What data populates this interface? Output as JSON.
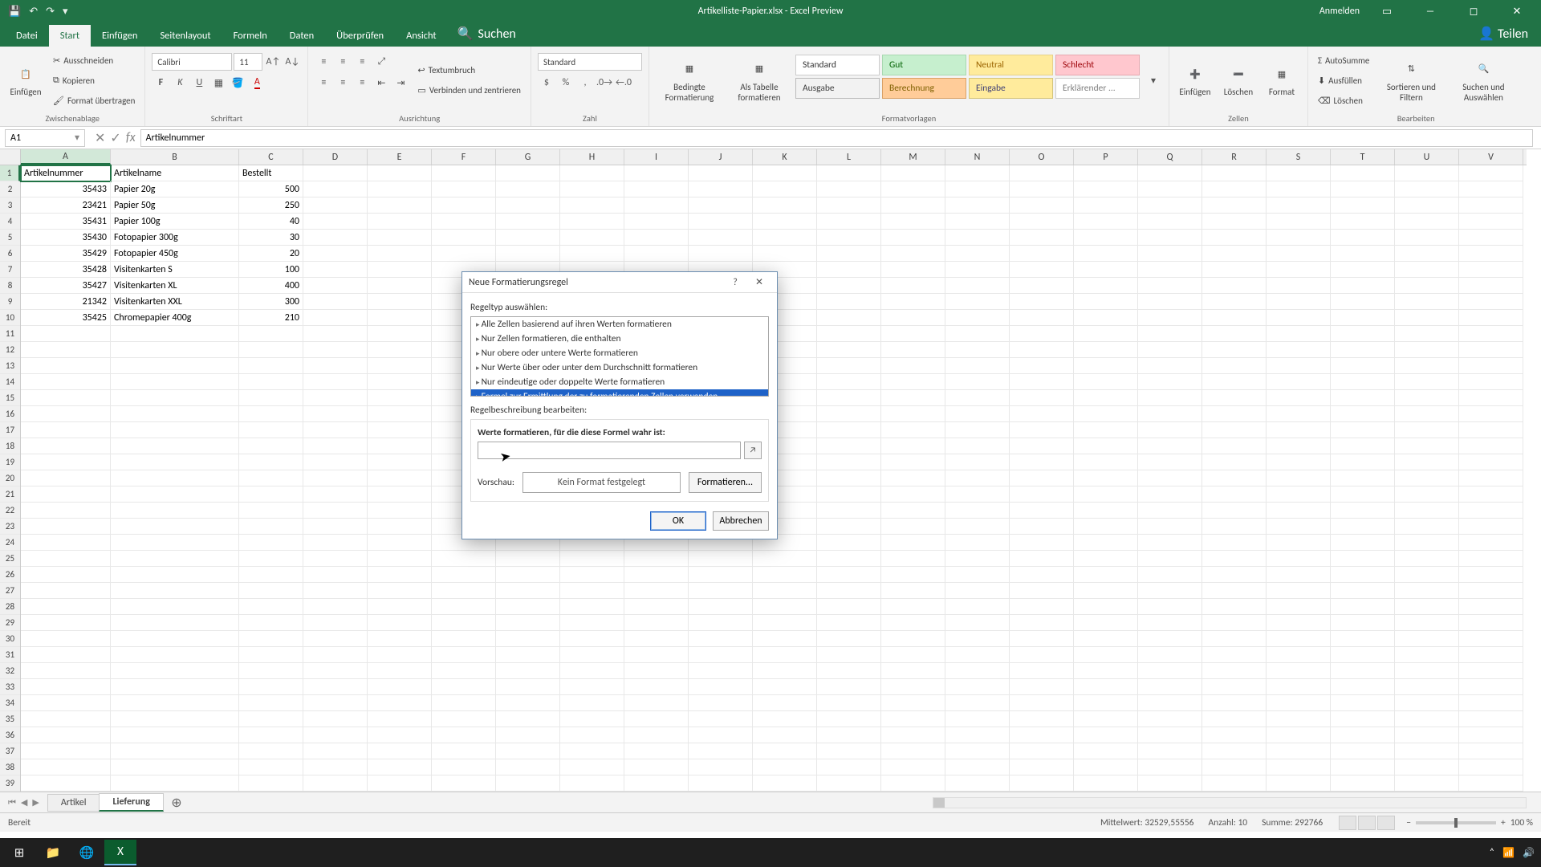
{
  "titlebar": {
    "title": "Artikelliste-Papier.xlsx - Excel Preview",
    "signin": "Anmelden"
  },
  "tabs": {
    "items": [
      "Datei",
      "Start",
      "Einfügen",
      "Seitenlayout",
      "Formeln",
      "Daten",
      "Überprüfen",
      "Ansicht"
    ],
    "active": "Start",
    "search": "Suchen",
    "share": "Teilen"
  },
  "ribbon": {
    "clipboard": {
      "paste": "Einfügen",
      "cut": "Ausschneiden",
      "copy": "Kopieren",
      "format_painter": "Format übertragen",
      "label": "Zwischenablage"
    },
    "font": {
      "name": "Calibri",
      "size": "11",
      "label": "Schriftart"
    },
    "alignment": {
      "wrap": "Textumbruch",
      "merge": "Verbinden und zentrieren",
      "label": "Ausrichtung"
    },
    "number": {
      "format": "Standard",
      "label": "Zahl"
    },
    "styles": {
      "cond": "Bedingte Formatierung",
      "astable": "Als Tabelle formatieren",
      "label": "Formatvorlagen",
      "gallery": [
        {
          "text": "Standard",
          "bg": "#ffffff",
          "fg": "#333",
          "border": "#ccc"
        },
        {
          "text": "Gut",
          "bg": "#c6efce",
          "fg": "#006100",
          "border": "#a8d8b0"
        },
        {
          "text": "Neutral",
          "bg": "#ffeb9c",
          "fg": "#9c6500",
          "border": "#e6d18a"
        },
        {
          "text": "Schlecht",
          "bg": "#ffc7ce",
          "fg": "#9c0006",
          "border": "#e6a8b0"
        },
        {
          "text": "Ausgabe",
          "bg": "#f2f2f2",
          "fg": "#3f3f3f",
          "border": "#bbb"
        },
        {
          "text": "Berechnung",
          "bg": "#ffcc99",
          "fg": "#7f6000",
          "border": "#d9a066"
        },
        {
          "text": "Eingabe",
          "bg": "#ffeb9c",
          "fg": "#3f3f76",
          "border": "#d4c47a"
        },
        {
          "text": "Erklärender ...",
          "bg": "#ffffff",
          "fg": "#7f7f7f",
          "border": "#ccc"
        }
      ]
    },
    "cells": {
      "insert": "Einfügen",
      "delete": "Löschen",
      "format": "Format",
      "label": "Zellen"
    },
    "editing": {
      "autosum": "AutoSumme",
      "fill": "Ausfüllen",
      "clear": "Löschen",
      "sort": "Sortieren und Filtern",
      "find": "Suchen und Auswählen",
      "label": "Bearbeiten"
    }
  },
  "fxbar": {
    "name": "A1",
    "formula": "Artikelnummer"
  },
  "grid": {
    "cols": [
      "A",
      "B",
      "C",
      "D",
      "E",
      "F",
      "G",
      "H",
      "I",
      "J",
      "K",
      "L",
      "M",
      "N",
      "O",
      "P",
      "Q",
      "R",
      "S",
      "T",
      "U",
      "V"
    ],
    "rows": 39,
    "headers_row": [
      "Artikelnummer",
      "Artikelname",
      "Bestellt"
    ],
    "data": [
      {
        "nr": "35433",
        "name": "Papier 20g",
        "qty": "500"
      },
      {
        "nr": "23421",
        "name": "Papier 50g",
        "qty": "250"
      },
      {
        "nr": "35431",
        "name": "Papier 100g",
        "qty": "40"
      },
      {
        "nr": "35430",
        "name": "Fotopapier 300g",
        "qty": "30"
      },
      {
        "nr": "35429",
        "name": "Fotopapier 450g",
        "qty": "20"
      },
      {
        "nr": "35428",
        "name": "Visitenkarten S",
        "qty": "100"
      },
      {
        "nr": "35427",
        "name": "Visitenkarten XL",
        "qty": "400"
      },
      {
        "nr": "21342",
        "name": "Visitenkarten XXL",
        "qty": "300"
      },
      {
        "nr": "35425",
        "name": "Chromepapier 400g",
        "qty": "210"
      }
    ]
  },
  "sheettabs": {
    "tabs": [
      "Artikel",
      "Lieferung"
    ],
    "active": "Lieferung"
  },
  "status": {
    "ready": "Bereit",
    "avg_label": "Mittelwert:",
    "avg": "32529,55556",
    "count_label": "Anzahl:",
    "count": "10",
    "sum_label": "Summe:",
    "sum": "292766",
    "zoom": "100 %"
  },
  "dialog": {
    "title": "Neue Formatierungsregel",
    "select_type": "Regeltyp auswählen:",
    "types": [
      "Alle Zellen basierend auf ihren Werten formatieren",
      "Nur Zellen formatieren, die enthalten",
      "Nur obere oder untere Werte formatieren",
      "Nur Werte über oder unter dem Durchschnitt formatieren",
      "Nur eindeutige oder doppelte Werte formatieren",
      "Formel zur Ermittlung der zu formatierenden Zellen verwenden"
    ],
    "selected_index": 5,
    "edit_desc": "Regelbeschreibung bearbeiten:",
    "formula_label": "Werte formatieren, für die diese Formel wahr ist:",
    "formula_value": "",
    "preview_label": "Vorschau:",
    "preview_text": "Kein Format festgelegt",
    "format_btn": "Formatieren...",
    "ok": "OK",
    "cancel": "Abbrechen"
  }
}
